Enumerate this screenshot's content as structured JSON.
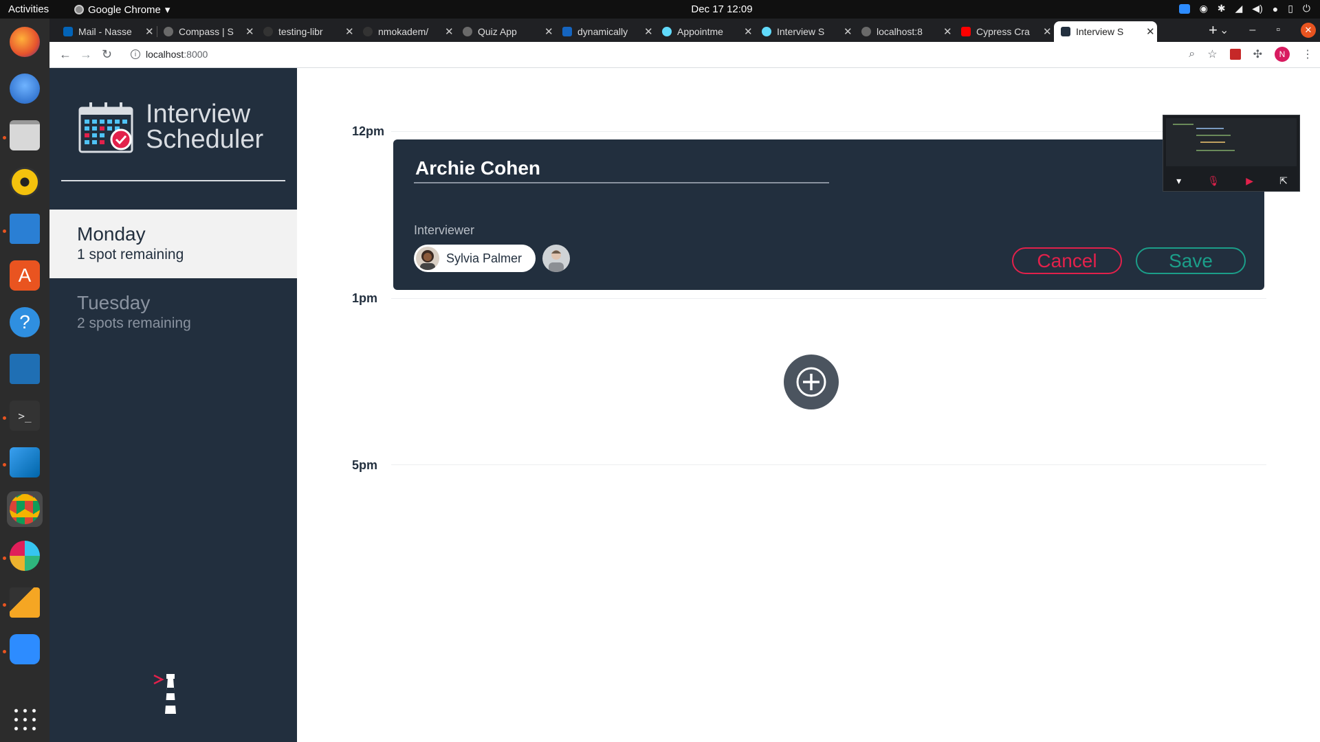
{
  "system": {
    "activities": "Activities",
    "app_name": "Google Chrome",
    "clock": "Dec 17  12:09"
  },
  "browser": {
    "tabs": [
      {
        "title": "Mail - Nasse"
      },
      {
        "title": "Compass | S"
      },
      {
        "title": "testing-libr"
      },
      {
        "title": "nmokadem/"
      },
      {
        "title": "Quiz App"
      },
      {
        "title": "dynamically"
      },
      {
        "title": "Appointme"
      },
      {
        "title": "Interview S"
      },
      {
        "title": "localhost:8"
      },
      {
        "title": "Cypress Cra"
      },
      {
        "title": "Interview S",
        "active": true
      }
    ],
    "url_host": "localhost",
    "url_port": ":8000",
    "avatar_letter": "N"
  },
  "app": {
    "logo_line1": "Interview",
    "logo_line2": "Scheduler",
    "days": [
      {
        "name": "Monday",
        "spots": "1 spot remaining",
        "selected": true
      },
      {
        "name": "Tuesday",
        "spots": "2 spots remaining",
        "selected": false
      }
    ],
    "times": [
      "12pm",
      "1pm",
      "5pm"
    ],
    "form": {
      "student_name": "Archie Cohen",
      "interviewer_label": "Interviewer",
      "selected_interviewer": "Sylvia Palmer",
      "cancel_label": "Cancel",
      "save_label": "Save"
    }
  },
  "colors": {
    "sidebar_bg": "#222f3e",
    "cancel": "#e2214b",
    "save": "#1b9e89"
  },
  "icons": [
    "add-icon",
    "calendar-logo-icon",
    "lighthouse-icon"
  ]
}
